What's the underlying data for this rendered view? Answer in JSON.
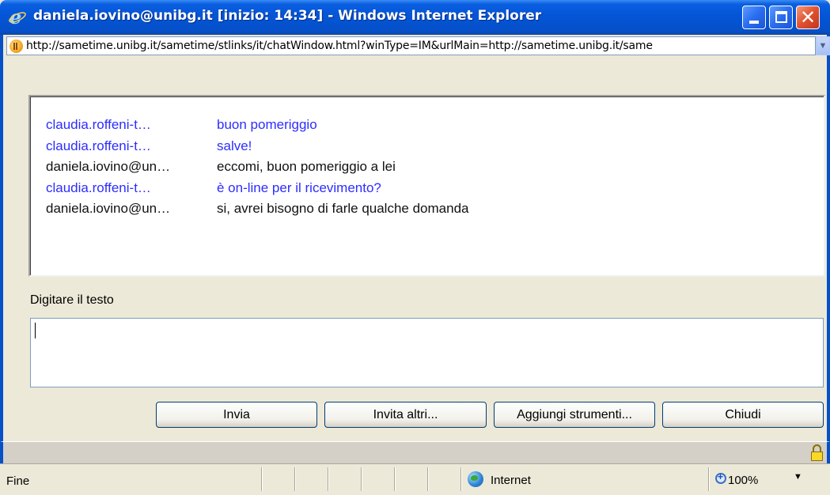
{
  "window": {
    "title": "daniela.iovino@unibg.it [inizio: 14:34] - Windows Internet Explorer",
    "address": "http://sametime.unibg.it/sametime/stlinks/it/chatWindow.html?winType=IM&urlMain=http://sametime.unibg.it/same"
  },
  "colors": {
    "title_bar": "#0556d8",
    "other_sender": "#2d2dff",
    "self_sender": "#111111"
  },
  "chat": {
    "messages": [
      {
        "from": "claudia.roffeni-t…",
        "text": "buon pomeriggio",
        "style": "blue"
      },
      {
        "from": "claudia.roffeni-t…",
        "text": "salve!",
        "style": "blue"
      },
      {
        "from": "daniela.iovino@un…",
        "text": "eccomi, buon pomeriggio a lei",
        "style": "black"
      },
      {
        "from": "claudia.roffeni-t…",
        "text": "è on-line per il ricevimento?",
        "style": "blue"
      },
      {
        "from": "daniela.iovino@un…",
        "text": "si, avrei bisogno di farle qualche domanda",
        "style": "black"
      }
    ],
    "input_label": "Digitare il testo",
    "input_value": ""
  },
  "buttons": {
    "send": "Invia",
    "invite": "Invita altri...",
    "tools": "Aggiungi strumenti...",
    "close": "Chiudi"
  },
  "statusbar": {
    "status": "Fine",
    "zone": "Internet",
    "zoom": "100%"
  },
  "icons": [
    "ie-logo-icon",
    "minimize-icon",
    "maximize-icon",
    "close-icon",
    "page-icon",
    "dropdown-arrow-icon",
    "lock-icon",
    "globe-icon",
    "zoom-icon"
  ]
}
